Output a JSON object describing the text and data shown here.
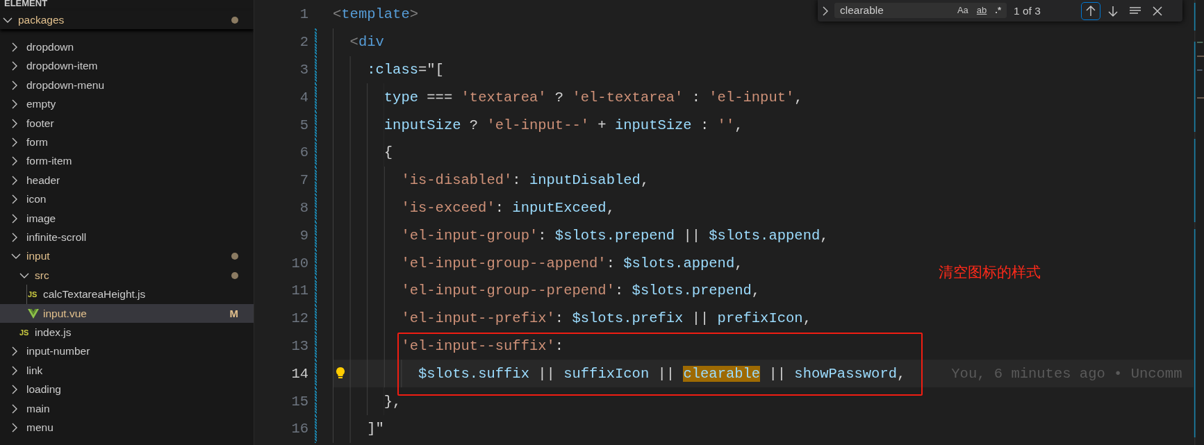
{
  "sidebar": {
    "section": "ELEMENT",
    "tree": {
      "label": "packages",
      "kind": "folder",
      "expanded": true,
      "modified": true,
      "selected": false,
      "children": [
        {
          "label": "dropdown",
          "kind": "folder",
          "expanded": false,
          "modified": false,
          "selected": false
        },
        {
          "label": "dropdown-item",
          "kind": "folder",
          "expanded": false,
          "modified": false,
          "selected": false
        },
        {
          "label": "dropdown-menu",
          "kind": "folder",
          "expanded": false,
          "modified": false,
          "selected": false
        },
        {
          "label": "empty",
          "kind": "folder",
          "expanded": false,
          "modified": false,
          "selected": false
        },
        {
          "label": "footer",
          "kind": "folder",
          "expanded": false,
          "modified": false,
          "selected": false
        },
        {
          "label": "form",
          "kind": "folder",
          "expanded": false,
          "modified": false,
          "selected": false
        },
        {
          "label": "form-item",
          "kind": "folder",
          "expanded": false,
          "modified": false,
          "selected": false
        },
        {
          "label": "header",
          "kind": "folder",
          "expanded": false,
          "modified": false,
          "selected": false
        },
        {
          "label": "icon",
          "kind": "folder",
          "expanded": false,
          "modified": false,
          "selected": false
        },
        {
          "label": "image",
          "kind": "folder",
          "expanded": false,
          "modified": false,
          "selected": false
        },
        {
          "label": "infinite-scroll",
          "kind": "folder",
          "expanded": false,
          "modified": false,
          "selected": false
        },
        {
          "label": "input",
          "kind": "folder",
          "expanded": true,
          "modified": true,
          "selected": false,
          "children": [
            {
              "label": "src",
              "kind": "folder",
              "expanded": true,
              "modified": true,
              "selected": false,
              "children": [
                {
                  "label": "calcTextareaHeight.js",
                  "kind": "js",
                  "icon_label": "JS",
                  "modified": false,
                  "selected": false
                },
                {
                  "label": "input.vue",
                  "kind": "vue",
                  "git_status": "M",
                  "modified": false,
                  "selected": true
                }
              ]
            },
            {
              "label": "index.js",
              "kind": "js",
              "icon_label": "JS",
              "modified": false,
              "selected": false
            }
          ]
        },
        {
          "label": "input-number",
          "kind": "folder",
          "expanded": false,
          "modified": false,
          "selected": false
        },
        {
          "label": "link",
          "kind": "folder",
          "expanded": false,
          "modified": false,
          "selected": false
        },
        {
          "label": "loading",
          "kind": "folder",
          "expanded": false,
          "modified": false,
          "selected": false
        },
        {
          "label": "main",
          "kind": "folder",
          "expanded": false,
          "modified": false,
          "selected": false
        },
        {
          "label": "menu",
          "kind": "folder",
          "expanded": false,
          "modified": false,
          "selected": false
        }
      ]
    }
  },
  "find_widget": {
    "query": "clearable",
    "replace_expanded": false,
    "options": [
      {
        "text": "Aa",
        "on": false
      },
      {
        "text": "ab",
        "on": false
      },
      {
        "text": ".*",
        "on": false
      }
    ],
    "count": "1 of 3"
  },
  "editor": {
    "annotation": "清空图标的样式",
    "lines": [
      {
        "number": "1",
        "changed": false,
        "current": false,
        "boxed": false,
        "tokens": [
          {
            "text": "<",
            "kind": "bracket"
          },
          {
            "text": "template",
            "kind": "tag"
          },
          {
            "text": ">",
            "kind": "bracket"
          }
        ]
      },
      {
        "number": "2",
        "changed": true,
        "current": false,
        "boxed": false,
        "tokens": [
          {
            "text": "  <",
            "kind": "bracket"
          },
          {
            "text": "div",
            "kind": "tag"
          }
        ]
      },
      {
        "number": "3",
        "changed": true,
        "current": false,
        "boxed": false,
        "tokens": [
          {
            "text": "    :class",
            "kind": "attr"
          },
          {
            "text": "=\"[",
            "kind": "punct"
          }
        ]
      },
      {
        "number": "4",
        "changed": true,
        "current": false,
        "boxed": false,
        "tokens": [
          {
            "text": "      type",
            "kind": "var"
          },
          {
            "text": " === ",
            "kind": "punct"
          },
          {
            "text": "'textarea'",
            "kind": "string"
          },
          {
            "text": " ? ",
            "kind": "punct"
          },
          {
            "text": "'el-textarea'",
            "kind": "string"
          },
          {
            "text": " : ",
            "kind": "punct"
          },
          {
            "text": "'el-input'",
            "kind": "string"
          },
          {
            "text": ",",
            "kind": "punct"
          }
        ]
      },
      {
        "number": "5",
        "changed": true,
        "current": false,
        "boxed": false,
        "tokens": [
          {
            "text": "      inputSize",
            "kind": "var"
          },
          {
            "text": " ? ",
            "kind": "punct"
          },
          {
            "text": "'el-input--'",
            "kind": "string"
          },
          {
            "text": " + ",
            "kind": "punct"
          },
          {
            "text": "inputSize",
            "kind": "var"
          },
          {
            "text": " : ",
            "kind": "punct"
          },
          {
            "text": "''",
            "kind": "string"
          },
          {
            "text": ",",
            "kind": "punct"
          }
        ]
      },
      {
        "number": "6",
        "changed": true,
        "current": false,
        "boxed": false,
        "tokens": [
          {
            "text": "      {",
            "kind": "punct"
          }
        ]
      },
      {
        "number": "7",
        "changed": true,
        "current": false,
        "boxed": false,
        "tokens": [
          {
            "text": "        'is-disabled'",
            "kind": "string"
          },
          {
            "text": ": ",
            "kind": "punct"
          },
          {
            "text": "inputDisabled",
            "kind": "var"
          },
          {
            "text": ",",
            "kind": "punct"
          }
        ]
      },
      {
        "number": "8",
        "changed": true,
        "current": false,
        "boxed": false,
        "tokens": [
          {
            "text": "        'is-exceed'",
            "kind": "string"
          },
          {
            "text": ": ",
            "kind": "punct"
          },
          {
            "text": "inputExceed",
            "kind": "var"
          },
          {
            "text": ",",
            "kind": "punct"
          }
        ]
      },
      {
        "number": "9",
        "changed": true,
        "current": false,
        "boxed": false,
        "tokens": [
          {
            "text": "        'el-input-group'",
            "kind": "string"
          },
          {
            "text": ": ",
            "kind": "punct"
          },
          {
            "text": "$slots.prepend",
            "kind": "var"
          },
          {
            "text": " || ",
            "kind": "punct"
          },
          {
            "text": "$slots.append",
            "kind": "var"
          },
          {
            "text": ",",
            "kind": "punct"
          }
        ]
      },
      {
        "number": "10",
        "changed": true,
        "current": false,
        "boxed": false,
        "tokens": [
          {
            "text": "        'el-input-group--append'",
            "kind": "string"
          },
          {
            "text": ": ",
            "kind": "punct"
          },
          {
            "text": "$slots.append",
            "kind": "var"
          },
          {
            "text": ",",
            "kind": "punct"
          }
        ]
      },
      {
        "number": "11",
        "changed": true,
        "current": false,
        "boxed": false,
        "tokens": [
          {
            "text": "        'el-input-group--prepend'",
            "kind": "string"
          },
          {
            "text": ": ",
            "kind": "punct"
          },
          {
            "text": "$slots.prepend",
            "kind": "var"
          },
          {
            "text": ",",
            "kind": "punct"
          }
        ]
      },
      {
        "number": "12",
        "changed": true,
        "current": false,
        "boxed": false,
        "tokens": [
          {
            "text": "        'el-input--prefix'",
            "kind": "string"
          },
          {
            "text": ": ",
            "kind": "punct"
          },
          {
            "text": "$slots.prefix",
            "kind": "var"
          },
          {
            "text": " || ",
            "kind": "punct"
          },
          {
            "text": "prefixIcon",
            "kind": "var"
          },
          {
            "text": ",",
            "kind": "punct"
          }
        ]
      },
      {
        "number": "13",
        "changed": true,
        "current": false,
        "boxed": true,
        "tokens": [
          {
            "text": "        'el-input--suffix'",
            "kind": "string"
          },
          {
            "text": ":",
            "kind": "punct"
          }
        ]
      },
      {
        "number": "14",
        "changed": true,
        "current": true,
        "boxed": true,
        "lightbulb": true,
        "blame": "You, 6 minutes ago • Uncomm",
        "tokens": [
          {
            "text": "          $slots.suffix",
            "kind": "var"
          },
          {
            "text": " || ",
            "kind": "punct"
          },
          {
            "text": "suffixIcon",
            "kind": "var"
          },
          {
            "text": " || ",
            "kind": "punct"
          },
          {
            "text": "clearable",
            "kind": "match"
          },
          {
            "text": " || ",
            "kind": "punct"
          },
          {
            "text": "showPassword",
            "kind": "var"
          },
          {
            "text": ",",
            "kind": "punct"
          }
        ]
      },
      {
        "number": "15",
        "changed": true,
        "current": false,
        "boxed": false,
        "tokens": [
          {
            "text": "      },",
            "kind": "punct"
          }
        ]
      },
      {
        "number": "16",
        "changed": true,
        "current": false,
        "boxed": false,
        "tokens": [
          {
            "text": "    ]\"",
            "kind": "punct"
          }
        ]
      }
    ]
  }
}
